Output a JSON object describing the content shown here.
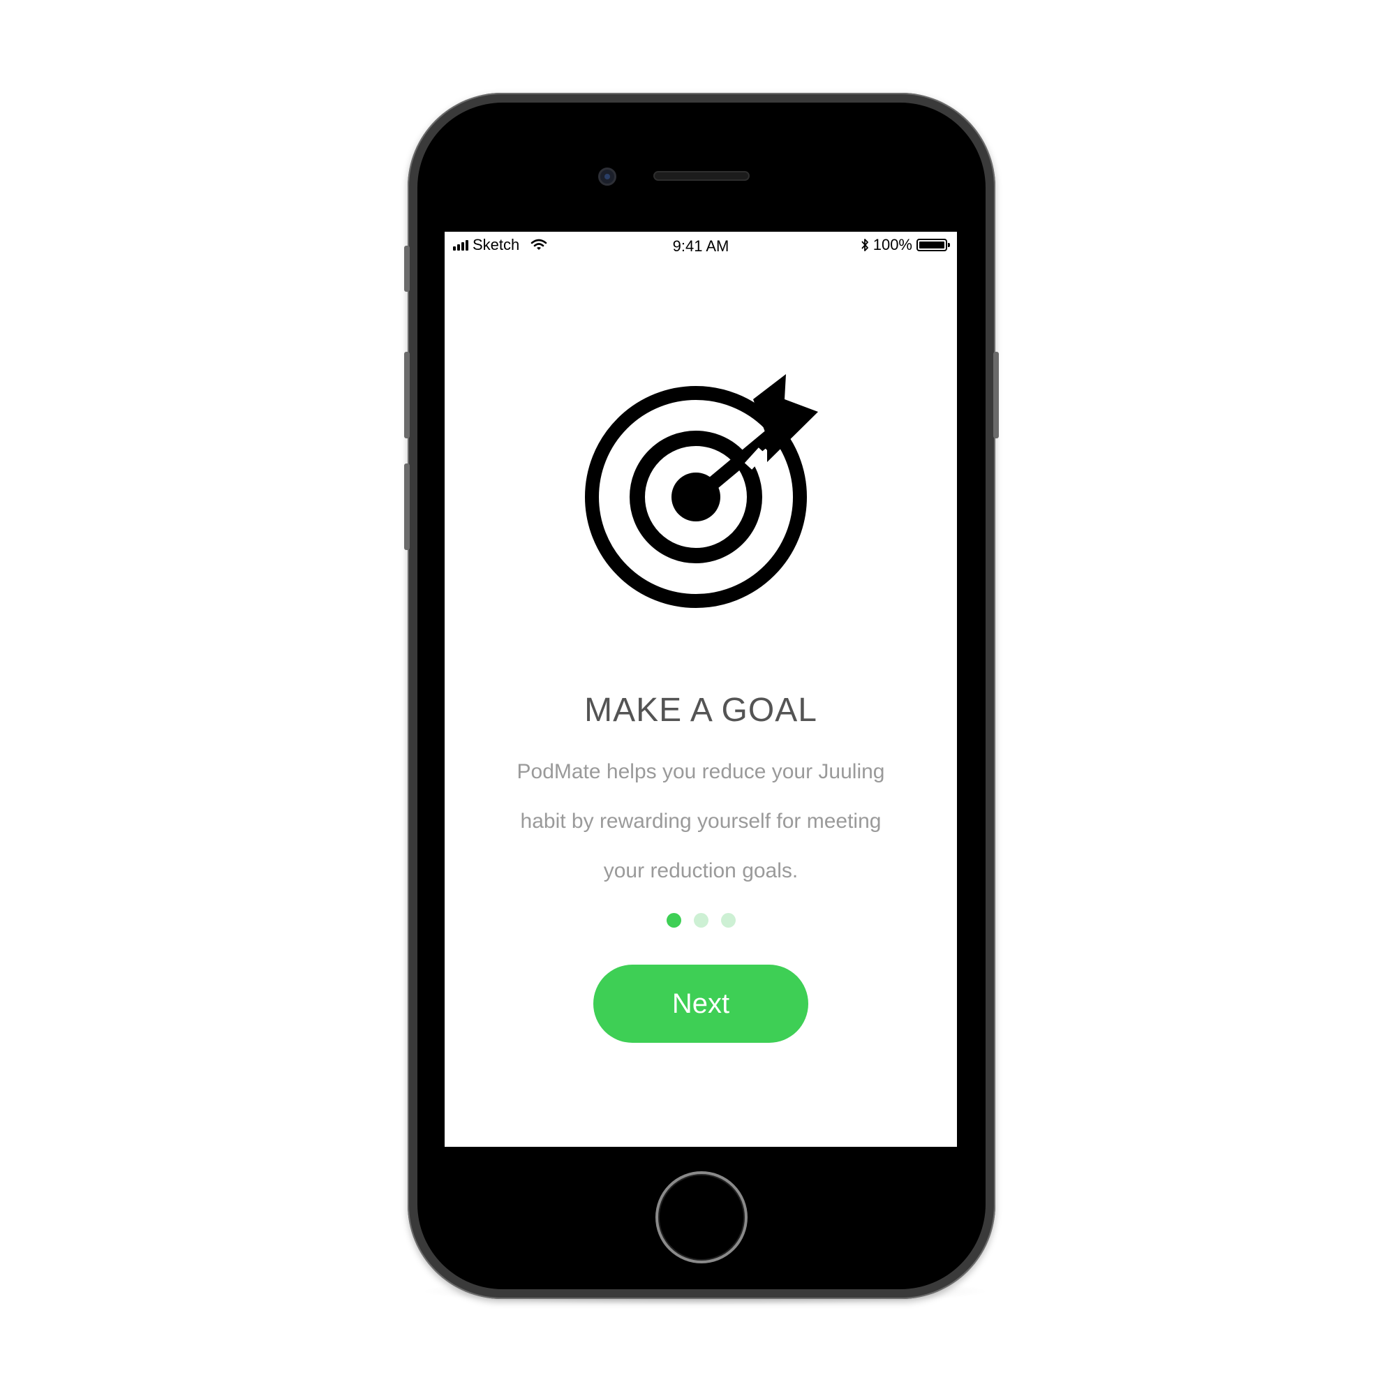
{
  "status_bar": {
    "carrier": "Sketch",
    "time": "9:41 AM",
    "battery": "100%",
    "icons": [
      "signal-icon",
      "wifi-icon",
      "bluetooth-icon",
      "battery-icon"
    ]
  },
  "onboarding": {
    "illustration": "target-icon",
    "title": "MAKE A GOAL",
    "description_lines": [
      "PodMate helps you reduce your Juuling",
      "habit by rewarding yourself for meeting",
      "your reduction goals."
    ],
    "page_indicator": {
      "total": 3,
      "current": 1
    },
    "next_label": "Next"
  },
  "colors": {
    "accent": "#3ecf55",
    "accent_light": "#cdf0d4",
    "title": "#545454",
    "body_text": "#9a9a9a",
    "device": "#000000"
  }
}
